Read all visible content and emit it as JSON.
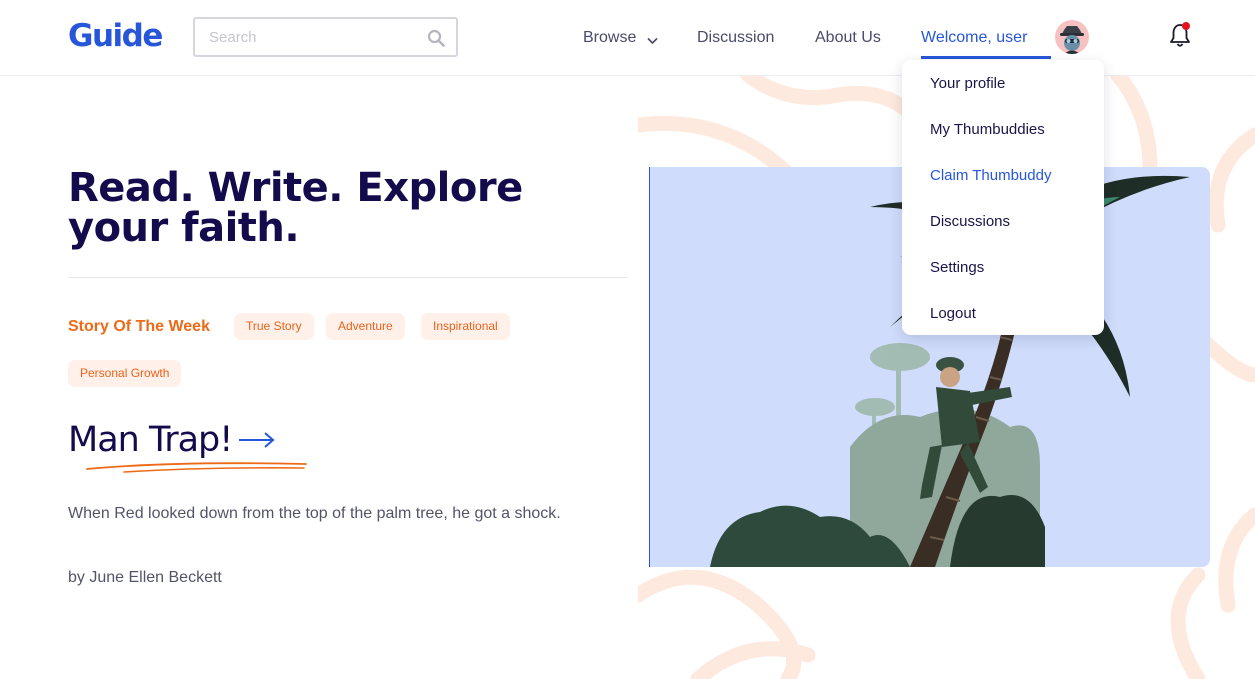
{
  "header": {
    "logo": "Guide",
    "search": {
      "placeholder": "Search",
      "value": ""
    },
    "nav": {
      "browse": "Browse",
      "discussion": "Discussion",
      "about": "About Us",
      "welcome": "Welcome, user"
    },
    "colors": {
      "accent": "#2756d9",
      "notification_dot": "#e8101a"
    }
  },
  "user_menu": {
    "items": [
      {
        "label": "Your profile"
      },
      {
        "label": "My Thumbuddies"
      },
      {
        "label": "Claim Thumbuddy",
        "active": true
      },
      {
        "label": "Discussions"
      },
      {
        "label": "Settings"
      },
      {
        "label": "Logout"
      }
    ]
  },
  "hero": {
    "headline": "Read. Write. Explore your faith.",
    "story_label": "Story Of The Week",
    "tags": [
      "True Story",
      "Adventure",
      "Inspirational",
      "Personal Growth"
    ],
    "story_title": "Man Trap!",
    "excerpt": "When Red looked down from the top of the palm tree, he got a shock.",
    "author": "by June Ellen Beckett",
    "colors": {
      "headline": "#140b4d",
      "tag_text": "#e8621a",
      "tag_bg": "#fff1ea"
    }
  },
  "icons": [
    "search-icon",
    "chevron-down-icon",
    "bell-icon",
    "avatar-icon",
    "arrow-right-icon"
  ]
}
